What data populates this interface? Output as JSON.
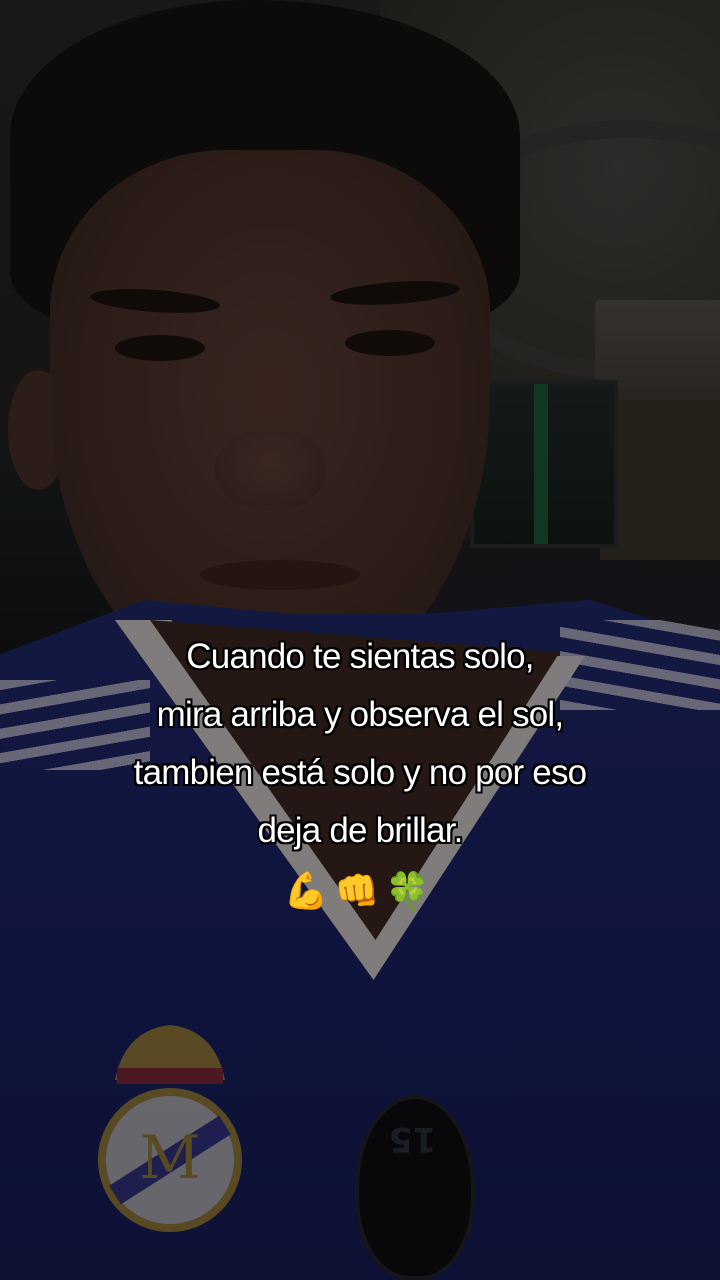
{
  "caption": {
    "lines": [
      "Cuando te sientas solo,",
      "mira arriba y observa el sol,",
      "tambien está solo y no por eso",
      "deja de brillar."
    ],
    "emojis": "💪👊🍀"
  },
  "jersey": {
    "badge_number": "15"
  }
}
